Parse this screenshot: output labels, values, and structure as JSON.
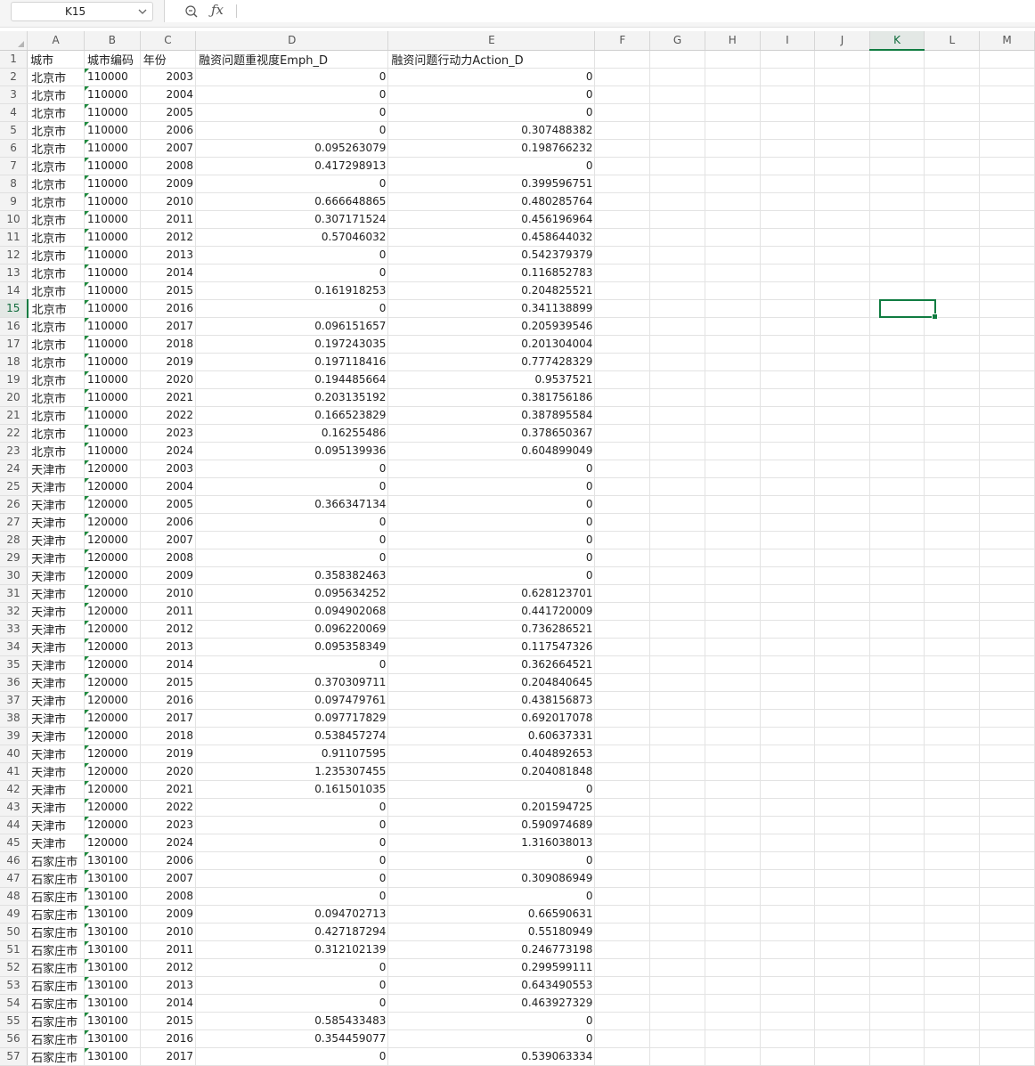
{
  "name_box": "K15",
  "formula": "",
  "columns": [
    "A",
    "B",
    "C",
    "D",
    "E",
    "F",
    "G",
    "H",
    "I",
    "J",
    "K",
    "L",
    "M"
  ],
  "header_row": {
    "a": "城市",
    "b": "城市编码",
    "c": "年份",
    "d": "融资问题重视度Emph_D",
    "e": "融资问题行动力Action_D"
  },
  "rows": [
    {
      "n": "2",
      "a": "北京市",
      "b": "110000",
      "c": "2003",
      "d": "0",
      "e": "0"
    },
    {
      "n": "3",
      "a": "北京市",
      "b": "110000",
      "c": "2004",
      "d": "0",
      "e": "0"
    },
    {
      "n": "4",
      "a": "北京市",
      "b": "110000",
      "c": "2005",
      "d": "0",
      "e": "0"
    },
    {
      "n": "5",
      "a": "北京市",
      "b": "110000",
      "c": "2006",
      "d": "0",
      "e": "0.307488382"
    },
    {
      "n": "6",
      "a": "北京市",
      "b": "110000",
      "c": "2007",
      "d": "0.095263079",
      "e": "0.198766232"
    },
    {
      "n": "7",
      "a": "北京市",
      "b": "110000",
      "c": "2008",
      "d": "0.417298913",
      "e": "0"
    },
    {
      "n": "8",
      "a": "北京市",
      "b": "110000",
      "c": "2009",
      "d": "0",
      "e": "0.399596751"
    },
    {
      "n": "9",
      "a": "北京市",
      "b": "110000",
      "c": "2010",
      "d": "0.666648865",
      "e": "0.480285764"
    },
    {
      "n": "10",
      "a": "北京市",
      "b": "110000",
      "c": "2011",
      "d": "0.307171524",
      "e": "0.456196964"
    },
    {
      "n": "11",
      "a": "北京市",
      "b": "110000",
      "c": "2012",
      "d": "0.57046032",
      "e": "0.458644032"
    },
    {
      "n": "12",
      "a": "北京市",
      "b": "110000",
      "c": "2013",
      "d": "0",
      "e": "0.542379379"
    },
    {
      "n": "13",
      "a": "北京市",
      "b": "110000",
      "c": "2014",
      "d": "0",
      "e": "0.116852783"
    },
    {
      "n": "14",
      "a": "北京市",
      "b": "110000",
      "c": "2015",
      "d": "0.161918253",
      "e": "0.204825521"
    },
    {
      "n": "15",
      "a": "北京市",
      "b": "110000",
      "c": "2016",
      "d": "0",
      "e": "0.341138899"
    },
    {
      "n": "16",
      "a": "北京市",
      "b": "110000",
      "c": "2017",
      "d": "0.096151657",
      "e": "0.205939546"
    },
    {
      "n": "17",
      "a": "北京市",
      "b": "110000",
      "c": "2018",
      "d": "0.197243035",
      "e": "0.201304004"
    },
    {
      "n": "18",
      "a": "北京市",
      "b": "110000",
      "c": "2019",
      "d": "0.197118416",
      "e": "0.777428329"
    },
    {
      "n": "19",
      "a": "北京市",
      "b": "110000",
      "c": "2020",
      "d": "0.194485664",
      "e": "0.9537521"
    },
    {
      "n": "20",
      "a": "北京市",
      "b": "110000",
      "c": "2021",
      "d": "0.203135192",
      "e": "0.381756186"
    },
    {
      "n": "21",
      "a": "北京市",
      "b": "110000",
      "c": "2022",
      "d": "0.166523829",
      "e": "0.387895584"
    },
    {
      "n": "22",
      "a": "北京市",
      "b": "110000",
      "c": "2023",
      "d": "0.16255486",
      "e": "0.378650367"
    },
    {
      "n": "23",
      "a": "北京市",
      "b": "110000",
      "c": "2024",
      "d": "0.095139936",
      "e": "0.604899049"
    },
    {
      "n": "24",
      "a": "天津市",
      "b": "120000",
      "c": "2003",
      "d": "0",
      "e": "0"
    },
    {
      "n": "25",
      "a": "天津市",
      "b": "120000",
      "c": "2004",
      "d": "0",
      "e": "0"
    },
    {
      "n": "26",
      "a": "天津市",
      "b": "120000",
      "c": "2005",
      "d": "0.366347134",
      "e": "0"
    },
    {
      "n": "27",
      "a": "天津市",
      "b": "120000",
      "c": "2006",
      "d": "0",
      "e": "0"
    },
    {
      "n": "28",
      "a": "天津市",
      "b": "120000",
      "c": "2007",
      "d": "0",
      "e": "0"
    },
    {
      "n": "29",
      "a": "天津市",
      "b": "120000",
      "c": "2008",
      "d": "0",
      "e": "0"
    },
    {
      "n": "30",
      "a": "天津市",
      "b": "120000",
      "c": "2009",
      "d": "0.358382463",
      "e": "0"
    },
    {
      "n": "31",
      "a": "天津市",
      "b": "120000",
      "c": "2010",
      "d": "0.095634252",
      "e": "0.628123701"
    },
    {
      "n": "32",
      "a": "天津市",
      "b": "120000",
      "c": "2011",
      "d": "0.094902068",
      "e": "0.441720009"
    },
    {
      "n": "33",
      "a": "天津市",
      "b": "120000",
      "c": "2012",
      "d": "0.096220069",
      "e": "0.736286521"
    },
    {
      "n": "34",
      "a": "天津市",
      "b": "120000",
      "c": "2013",
      "d": "0.095358349",
      "e": "0.117547326"
    },
    {
      "n": "35",
      "a": "天津市",
      "b": "120000",
      "c": "2014",
      "d": "0",
      "e": "0.362664521"
    },
    {
      "n": "36",
      "a": "天津市",
      "b": "120000",
      "c": "2015",
      "d": "0.370309711",
      "e": "0.204840645"
    },
    {
      "n": "37",
      "a": "天津市",
      "b": "120000",
      "c": "2016",
      "d": "0.097479761",
      "e": "0.438156873"
    },
    {
      "n": "38",
      "a": "天津市",
      "b": "120000",
      "c": "2017",
      "d": "0.097717829",
      "e": "0.692017078"
    },
    {
      "n": "39",
      "a": "天津市",
      "b": "120000",
      "c": "2018",
      "d": "0.538457274",
      "e": "0.60637331"
    },
    {
      "n": "40",
      "a": "天津市",
      "b": "120000",
      "c": "2019",
      "d": "0.91107595",
      "e": "0.404892653"
    },
    {
      "n": "41",
      "a": "天津市",
      "b": "120000",
      "c": "2020",
      "d": "1.235307455",
      "e": "0.204081848"
    },
    {
      "n": "42",
      "a": "天津市",
      "b": "120000",
      "c": "2021",
      "d": "0.161501035",
      "e": "0"
    },
    {
      "n": "43",
      "a": "天津市",
      "b": "120000",
      "c": "2022",
      "d": "0",
      "e": "0.201594725"
    },
    {
      "n": "44",
      "a": "天津市",
      "b": "120000",
      "c": "2023",
      "d": "0",
      "e": "0.590974689"
    },
    {
      "n": "45",
      "a": "天津市",
      "b": "120000",
      "c": "2024",
      "d": "0",
      "e": "1.316038013"
    },
    {
      "n": "46",
      "a": "石家庄市",
      "b": "130100",
      "c": "2006",
      "d": "0",
      "e": "0"
    },
    {
      "n": "47",
      "a": "石家庄市",
      "b": "130100",
      "c": "2007",
      "d": "0",
      "e": "0.309086949"
    },
    {
      "n": "48",
      "a": "石家庄市",
      "b": "130100",
      "c": "2008",
      "d": "0",
      "e": "0"
    },
    {
      "n": "49",
      "a": "石家庄市",
      "b": "130100",
      "c": "2009",
      "d": "0.094702713",
      "e": "0.66590631"
    },
    {
      "n": "50",
      "a": "石家庄市",
      "b": "130100",
      "c": "2010",
      "d": "0.427187294",
      "e": "0.55180949"
    },
    {
      "n": "51",
      "a": "石家庄市",
      "b": "130100",
      "c": "2011",
      "d": "0.312102139",
      "e": "0.246773198"
    },
    {
      "n": "52",
      "a": "石家庄市",
      "b": "130100",
      "c": "2012",
      "d": "0",
      "e": "0.299599111"
    },
    {
      "n": "53",
      "a": "石家庄市",
      "b": "130100",
      "c": "2013",
      "d": "0",
      "e": "0.643490553"
    },
    {
      "n": "54",
      "a": "石家庄市",
      "b": "130100",
      "c": "2014",
      "d": "0",
      "e": "0.463927329"
    },
    {
      "n": "55",
      "a": "石家庄市",
      "b": "130100",
      "c": "2015",
      "d": "0.585433483",
      "e": "0"
    },
    {
      "n": "56",
      "a": "石家庄市",
      "b": "130100",
      "c": "2016",
      "d": "0.354459077",
      "e": "0"
    },
    {
      "n": "57",
      "a": "石家庄市",
      "b": "130100",
      "c": "2017",
      "d": "0",
      "e": "0.539063334"
    }
  ],
  "active_cell": {
    "column": "K",
    "row": "15"
  },
  "accent_color": "#107c41",
  "icons": {
    "zoom": "zoom-icon",
    "fx": "function-icon",
    "dropdown": "chevron-down-icon"
  }
}
